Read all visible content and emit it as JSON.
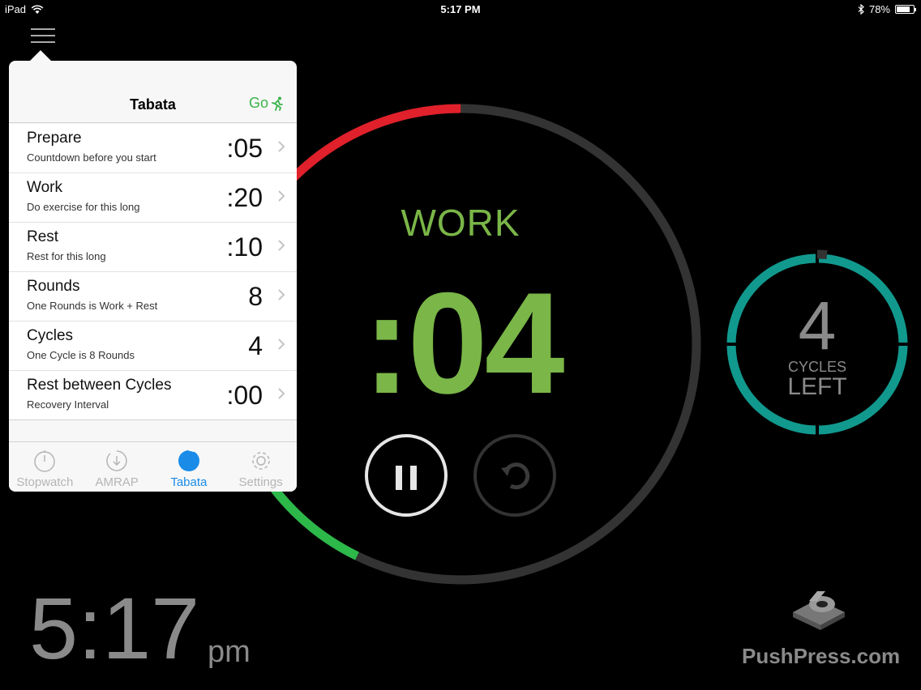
{
  "status_bar": {
    "device": "iPad",
    "time": "5:17 PM",
    "battery": "78%",
    "battery_level": 0.78
  },
  "timer": {
    "phase": "WORK",
    "countdown": ":04",
    "colors": {
      "work": "#7ab648",
      "elapsed": "#e0202a",
      "progress": "#2db84a",
      "track": "#333333",
      "cycles": "#11998e"
    }
  },
  "cycles": {
    "count": "4",
    "label": "CYCLES",
    "sub": "LEFT"
  },
  "clock": {
    "time": "5:17",
    "ampm": "pm"
  },
  "brand": {
    "name": "PushPress.com"
  },
  "popover": {
    "title": "Tabata",
    "go_label": "Go",
    "rows": [
      {
        "title": "Prepare",
        "subtitle": "Countdown before you start",
        "value": ":05"
      },
      {
        "title": "Work",
        "subtitle": "Do exercise for this long",
        "value": ":20"
      },
      {
        "title": "Rest",
        "subtitle": "Rest for this long",
        "value": ":10"
      },
      {
        "title": "Rounds",
        "subtitle": "One Rounds is Work + Rest",
        "value": "8"
      },
      {
        "title": "Cycles",
        "subtitle": "One Cycle is 8 Rounds",
        "value": "4"
      },
      {
        "title": "Rest between Cycles",
        "subtitle": "Recovery Interval",
        "value": ":00"
      }
    ],
    "tabs": [
      {
        "label": "Stopwatch",
        "icon": "stopwatch-icon"
      },
      {
        "label": "AMRAP",
        "icon": "amrap-icon"
      },
      {
        "label": "Tabata",
        "icon": "tabata-icon",
        "active": true
      },
      {
        "label": "Settings",
        "icon": "gear-icon"
      }
    ]
  }
}
